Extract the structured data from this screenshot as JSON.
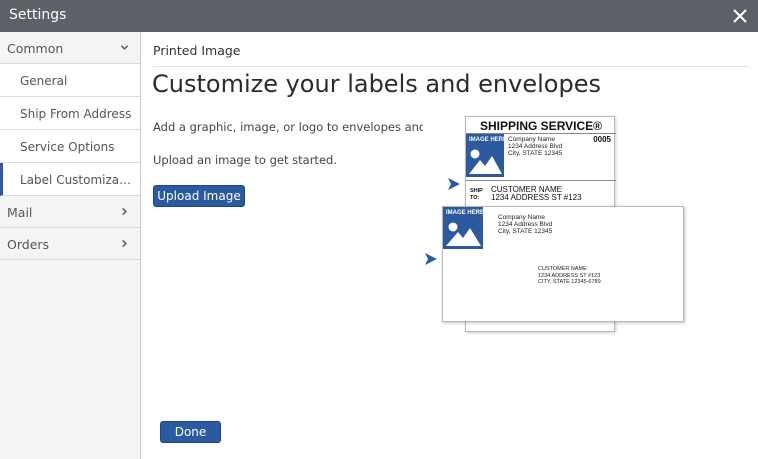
{
  "window": {
    "title": "Settings"
  },
  "sidebar": {
    "common_label": "Common",
    "common_items": [
      {
        "label": "General"
      },
      {
        "label": "Ship From Address"
      },
      {
        "label": "Service Options"
      },
      {
        "label": "Label Customization",
        "active": true
      }
    ],
    "mail_label": "Mail",
    "orders_label": "Orders"
  },
  "main": {
    "section_title": "Printed Image",
    "heading": "Customize your labels and envelopes",
    "description": "Add a graphic, image, or logo to envelopes and shipping labels.",
    "upload_hint": "Upload an image to get started.",
    "upload_button": "Upload Image",
    "done_button": "Done"
  },
  "illustration": {
    "service_title": "SHIPPING SERVICE®",
    "image_placeholder": "IMAGE HERE",
    "code": "0005",
    "sender_lines": [
      "Company Name",
      "1234 Address Blvd",
      "City, STATE 12345"
    ],
    "ship_to_label": [
      "SHIP",
      "TO:"
    ],
    "recipient_lines": [
      "CUSTOMER NAME",
      "1234 ADDRESS ST #123"
    ],
    "envelope_recipient_lines": [
      "CUSTOMER NAME",
      "1234 ADDRESS ST #123",
      "CITY, STATE 12345-6789"
    ]
  },
  "colors": {
    "titlebar": "#5e6167",
    "accent": "#2c5aa0",
    "sidebar_bg": "#f5f5f5"
  },
  "icons": {
    "close": "close-icon",
    "chevron_down": "chevron-down-icon",
    "chevron_right": "chevron-right-icon",
    "arrow": "arrow-right-icon",
    "image": "image-placeholder-icon"
  }
}
